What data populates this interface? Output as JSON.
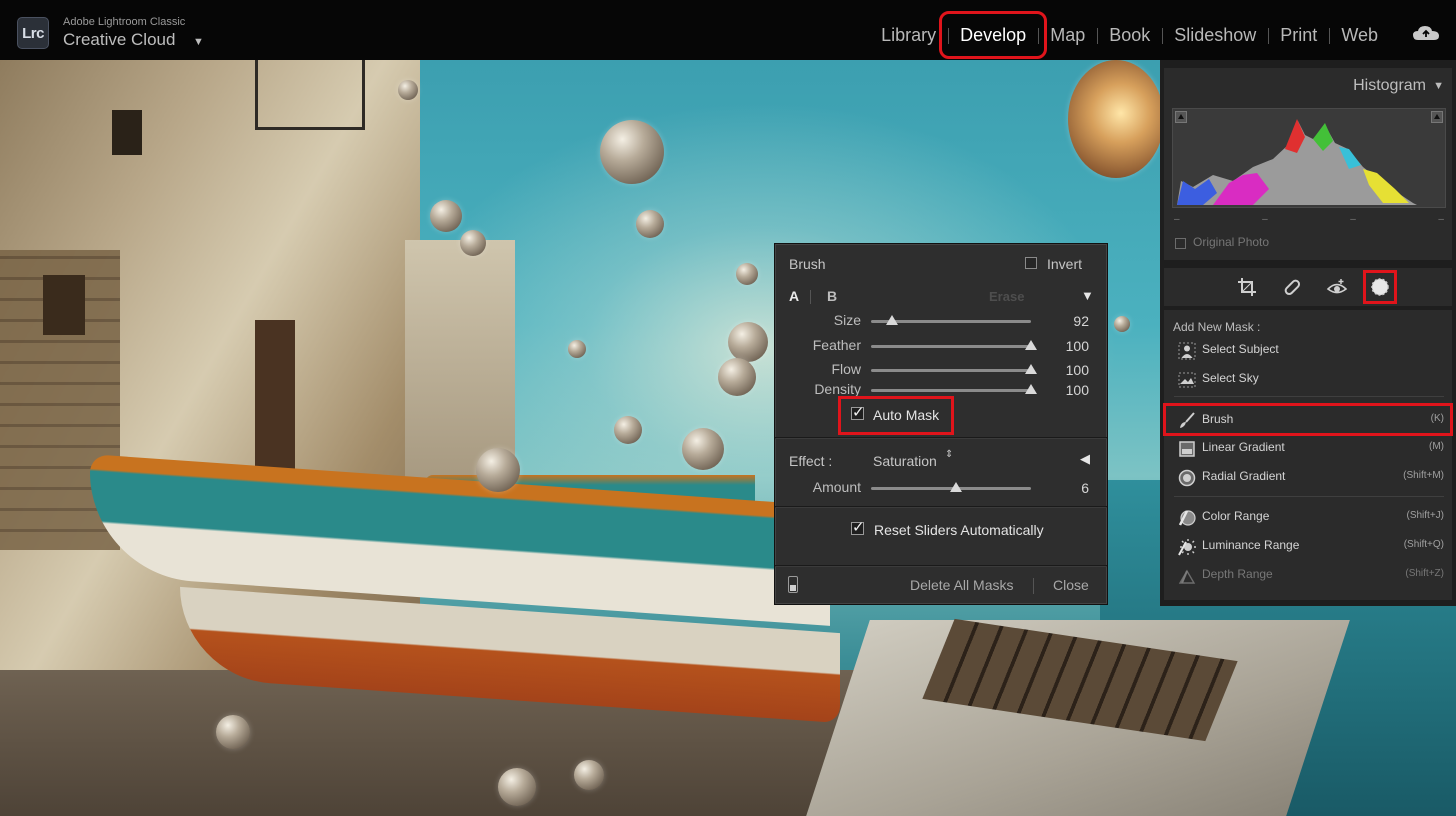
{
  "app": {
    "logo_text": "Lrc",
    "product_name": "Adobe Lightroom Classic",
    "account_name": "Creative Cloud",
    "account_caret": "▼"
  },
  "modules": [
    {
      "label": "Library",
      "active": false
    },
    {
      "label": "Develop",
      "active": true
    },
    {
      "label": "Map",
      "active": false
    },
    {
      "label": "Book",
      "active": false
    },
    {
      "label": "Slideshow",
      "active": false
    },
    {
      "label": "Print",
      "active": false
    },
    {
      "label": "Web",
      "active": false
    }
  ],
  "colors": {
    "highlight": "#e0141b",
    "panel_bg": "#2e2e2e",
    "right_panel_bg": "#2b2b2b"
  },
  "brush_panel": {
    "title": "Brush",
    "invert_label": "Invert",
    "tab_a": "A",
    "tab_b": "B",
    "tab_erase": "Erase",
    "collapse_glyph": "▼",
    "sliders": [
      {
        "label": "Size",
        "value": "92",
        "fraction": 0.13
      },
      {
        "label": "Feather",
        "value": "100",
        "fraction": 1.0
      },
      {
        "label": "Flow",
        "value": "100",
        "fraction": 1.0
      },
      {
        "label": "Density",
        "value": "100",
        "fraction": 1.0
      }
    ],
    "auto_mask": {
      "label": "Auto Mask",
      "checked": true
    },
    "effect": {
      "label": "Effect :",
      "value": "Saturation",
      "updown_glyph": "⇕",
      "expand_glyph": "◀"
    },
    "amount": {
      "label": "Amount",
      "value": "6",
      "fraction": 0.53
    },
    "reset_sliders": {
      "label": "Reset Sliders Automatically",
      "checked": true
    },
    "delete_all_label": "Delete All Masks",
    "close_label": "Close"
  },
  "histogram": {
    "title": "Histogram",
    "caret": "▼",
    "dashes": [
      "–",
      "–",
      "–",
      "–"
    ],
    "original_photo_label": "Original Photo"
  },
  "tools": [
    {
      "icon": "crop-icon"
    },
    {
      "icon": "healing-icon"
    },
    {
      "icon": "red-eye-icon"
    },
    {
      "icon": "masking-icon",
      "active": true
    }
  ],
  "masks": {
    "heading": "Add New Mask :",
    "items": [
      {
        "label": "Select Subject",
        "key": "",
        "icon": "person-icon"
      },
      {
        "label": "Select Sky",
        "key": "",
        "icon": "sky-icon"
      },
      {
        "label": "Brush",
        "key": "(K)",
        "icon": "brush-icon",
        "highlighted": true
      },
      {
        "label": "Linear Gradient",
        "key": "(M)",
        "icon": "linear-gradient-icon"
      },
      {
        "label": "Radial Gradient",
        "key": "(Shift+M)",
        "icon": "radial-gradient-icon"
      },
      {
        "label": "Color Range",
        "key": "(Shift+J)",
        "icon": "color-range-icon"
      },
      {
        "label": "Luminance Range",
        "key": "(Shift+Q)",
        "icon": "luminance-range-icon"
      },
      {
        "label": "Depth Range",
        "key": "(Shift+Z)",
        "icon": "depth-range-icon",
        "dim": true
      }
    ]
  }
}
